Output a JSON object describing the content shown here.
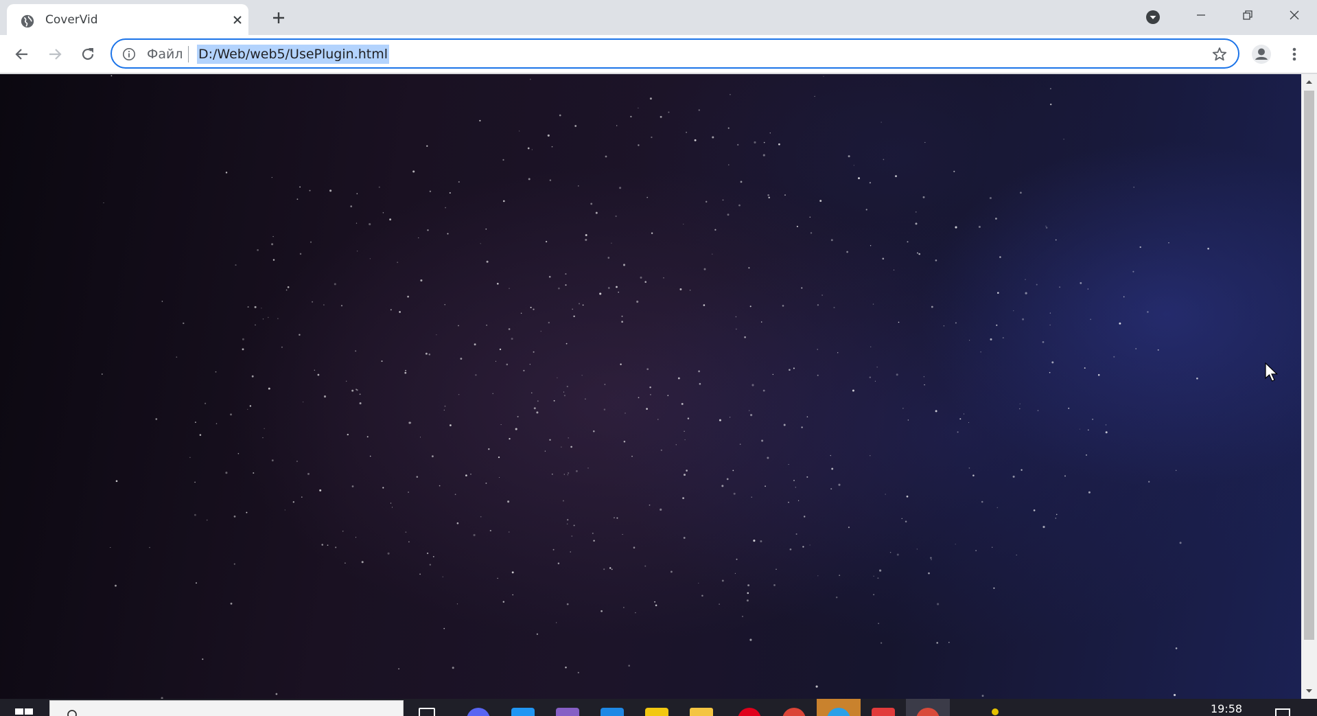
{
  "browser": {
    "tab": {
      "title": "CoverVid"
    },
    "address_bar": {
      "scheme_label": "Файл",
      "url": "D:/Web/web5/UsePlugin.html"
    }
  },
  "taskbar": {
    "clock": "19:58"
  },
  "colors": {
    "accent": "#1a73e8",
    "url_selection": "#b3d3fd",
    "taskbar": "#1f1f28"
  },
  "icons": [
    "globe-icon",
    "close-icon",
    "plus-icon",
    "tab-search-icon",
    "minimize-icon",
    "restore-icon",
    "back-icon",
    "forward-icon",
    "reload-icon",
    "info-icon",
    "star-icon",
    "profile-icon",
    "menu-icon"
  ]
}
